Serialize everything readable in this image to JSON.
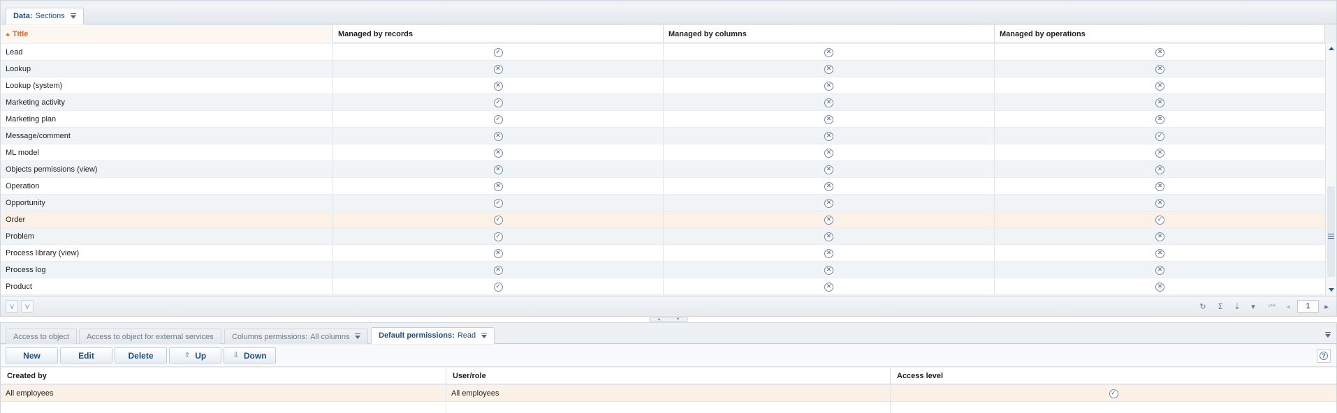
{
  "top_tab": {
    "key": "Data:",
    "value": "Sections"
  },
  "grid": {
    "columns": [
      "Title",
      "Managed by records",
      "Managed by columns",
      "Managed by operations"
    ],
    "sorted_column": "Title",
    "rows": [
      {
        "title": "Lead",
        "records": true,
        "columns": false,
        "operations": false
      },
      {
        "title": "Lookup",
        "records": false,
        "columns": false,
        "operations": false
      },
      {
        "title": "Lookup (system)",
        "records": false,
        "columns": false,
        "operations": false
      },
      {
        "title": "Marketing activity",
        "records": true,
        "columns": false,
        "operations": false
      },
      {
        "title": "Marketing plan",
        "records": true,
        "columns": false,
        "operations": false
      },
      {
        "title": "Message/comment",
        "records": false,
        "columns": false,
        "operations": true
      },
      {
        "title": "ML model",
        "records": false,
        "columns": false,
        "operations": false
      },
      {
        "title": "Objects permissions (view)",
        "records": false,
        "columns": false,
        "operations": false
      },
      {
        "title": "Operation",
        "records": false,
        "columns": false,
        "operations": false
      },
      {
        "title": "Opportunity",
        "records": true,
        "columns": false,
        "operations": false
      },
      {
        "title": "Order",
        "records": true,
        "columns": false,
        "operations": true,
        "selected": true
      },
      {
        "title": "Problem",
        "records": true,
        "columns": false,
        "operations": false
      },
      {
        "title": "Process library (view)",
        "records": false,
        "columns": false,
        "operations": false
      },
      {
        "title": "Process log",
        "records": false,
        "columns": false,
        "operations": false
      },
      {
        "title": "Product",
        "records": true,
        "columns": false,
        "operations": false
      }
    ]
  },
  "pagination": {
    "page": "1"
  },
  "bottom_tabs": [
    {
      "label": "Access to object",
      "value": ""
    },
    {
      "label": "Access to object for external services",
      "value": ""
    },
    {
      "label": "Columns permissions:",
      "value": "All columns"
    },
    {
      "label": "Default permissions:",
      "value": "Read",
      "active": true
    }
  ],
  "toolbar": {
    "new_label": "New",
    "edit_label": "Edit",
    "delete_label": "Delete",
    "up_label": "Up",
    "down_label": "Down"
  },
  "permissions": {
    "columns": [
      "Created by",
      "User/role",
      "Access level"
    ],
    "rows": [
      {
        "created_by": "All employees",
        "user_role": "All employees",
        "access_level": true
      }
    ]
  },
  "colors": {
    "accent": "#1c4f8c",
    "sorted": "#e4671b",
    "selected_row": "#fbf1e6"
  }
}
